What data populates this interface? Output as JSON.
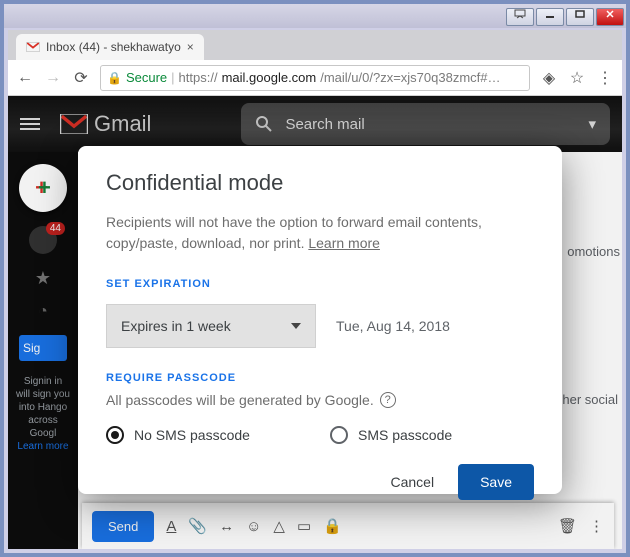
{
  "browser": {
    "tab_title": "Inbox (44) - shekhawatyo",
    "secure_label": "Secure",
    "url_prefix": "https://",
    "url_domain": "mail.google.com",
    "url_path": "/mail/u/0/?zx=xjs70q38zmcf#…"
  },
  "gmail": {
    "logo_text": "Gmail",
    "search_placeholder": "Search mail",
    "unread_badge": "44",
    "signin_label": "Sig",
    "rail_text": "Signin in will sign you into Hango across Googl",
    "rail_link": "Learn more",
    "promotions_tab": "omotions",
    "social_text": "her social",
    "send_label": "Send"
  },
  "dialog": {
    "title": "Confidential mode",
    "description": "Recipients will not have the option to forward email contents, copy/paste, download, nor print. ",
    "learn_more": "Learn more",
    "set_expiration_label": "SET EXPIRATION",
    "expiration_value": "Expires in 1 week",
    "expiration_date": "Tue, Aug 14, 2018",
    "require_passcode_label": "REQUIRE PASSCODE",
    "passcode_desc": "All passcodes will be generated by Google.",
    "no_sms_label": "No SMS passcode",
    "sms_label": "SMS passcode",
    "cancel_label": "Cancel",
    "save_label": "Save"
  }
}
